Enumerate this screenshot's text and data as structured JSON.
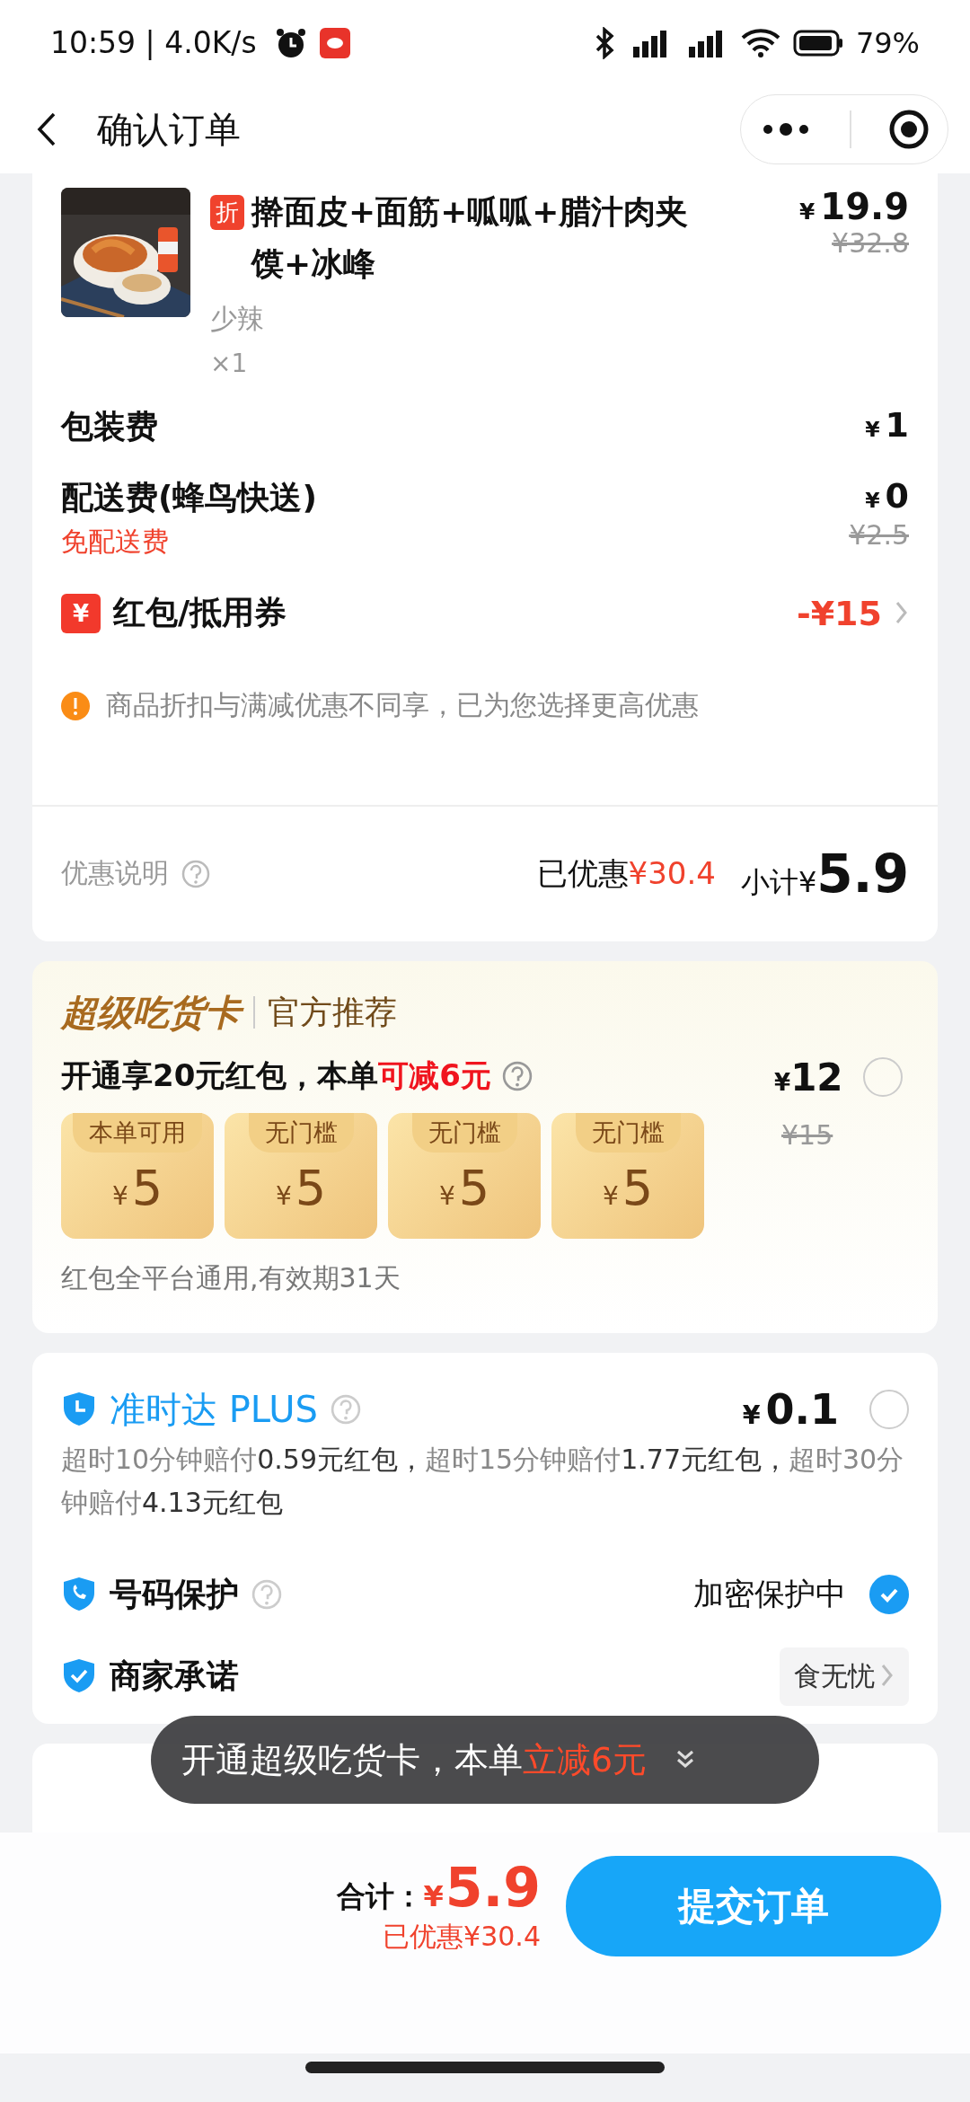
{
  "status_bar": {
    "time": "10:59 | 4.0K/s",
    "battery": "79%"
  },
  "nav": {
    "title": "确认订单"
  },
  "order": {
    "item": {
      "tag": "折",
      "name": "擀面皮+面筋+呱呱+腊汁肉夹馍+冰峰",
      "spec": "少辣",
      "qty": "×1",
      "currency": "¥",
      "price": "19.9",
      "original": "¥32.8"
    },
    "fees": [
      {
        "label": "包装费",
        "currency": "¥",
        "price": "1"
      },
      {
        "label": "配送费(蜂鸟快送)",
        "currency": "¥",
        "price": "0",
        "note": "免配送费",
        "original": "¥2.5"
      }
    ],
    "coupon": {
      "icon": "¥",
      "label": "红包/抵用券",
      "value": "-¥15"
    },
    "notice": "商品折扣与满减优惠不同享，已为您选择更高优惠",
    "summary": {
      "link": "优惠说明",
      "saved_label": "已优惠",
      "saved": "¥30.4",
      "subtotal_label": "小计¥",
      "subtotal": "5.9"
    }
  },
  "super_card": {
    "brand": "超级吃货卡",
    "tag": "官方推荐",
    "offer": "开通享20元红包，本单",
    "offer_highlight": "可减6元",
    "currency": "¥",
    "price": "12",
    "original": "¥15",
    "selected": false,
    "coupons": [
      {
        "label": "本单可用",
        "currency": "¥",
        "amount": "5"
      },
      {
        "label": "无门槛",
        "currency": "¥",
        "amount": "5"
      },
      {
        "label": "无门槛",
        "currency": "¥",
        "amount": "5"
      },
      {
        "label": "无门槛",
        "currency": "¥",
        "amount": "5"
      }
    ],
    "footnote": "红包全平台通用,有效期31天"
  },
  "services": {
    "ontime": {
      "title": "准时达 PLUS",
      "currency": "¥",
      "price": "0.1",
      "selected": false,
      "description": [
        {
          "text": "超时10分钟赔付",
          "emphasis": false
        },
        {
          "text": "0.59元红包，",
          "emphasis": true
        },
        {
          "text": "超时15分钟赔付",
          "emphasis": false
        },
        {
          "text": "1.77元红包，",
          "emphasis": true
        },
        {
          "text": "超时30分钟赔付",
          "emphasis": false
        },
        {
          "text": "4.13元红包",
          "emphasis": true
        }
      ]
    },
    "phone": {
      "label": "号码保护",
      "status": "加密保护中",
      "checked": true
    },
    "merchant": {
      "label": "商家承诺",
      "badge": "食无忧"
    }
  },
  "toast": {
    "text": "开通超级吃货卡，本单",
    "highlight": "立减6元"
  },
  "bottom_bar": {
    "total_label": "合计：",
    "currency": "¥",
    "total": "5.9",
    "saved": "已优惠¥30.4",
    "submit": "提交订单"
  }
}
